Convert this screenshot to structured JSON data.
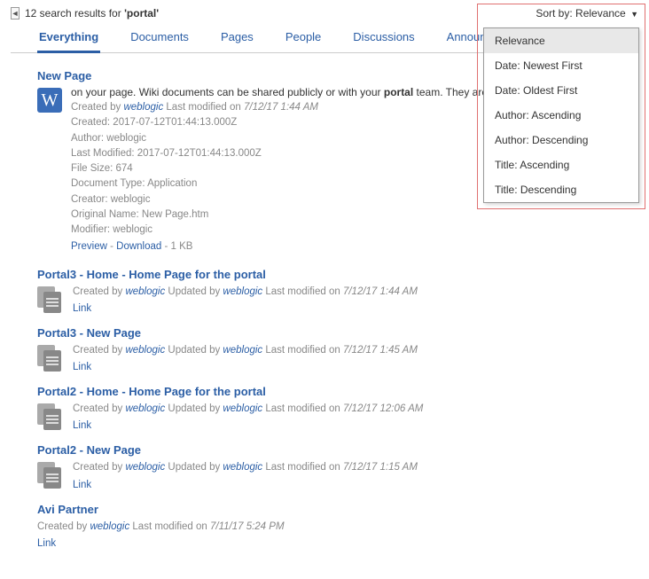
{
  "header": {
    "count_text": "12 search results for ",
    "query": "'portal'",
    "sort_label": "Sort by:",
    "sort_value": "Relevance"
  },
  "tabs": [
    {
      "label": "Everything",
      "active": true
    },
    {
      "label": "Documents",
      "active": false
    },
    {
      "label": "Pages",
      "active": false
    },
    {
      "label": "People",
      "active": false
    },
    {
      "label": "Discussions",
      "active": false
    },
    {
      "label": "Announcements",
      "active": false
    }
  ],
  "sort_options": [
    "Relevance",
    "Date: Newest First",
    "Date: Oldest First",
    "Author: Ascending",
    "Author: Descending",
    "Title: Ascending",
    "Title: Descending"
  ],
  "results": {
    "r0": {
      "title": "New Page",
      "snippet_pre": "on your page. Wiki documents can be shared publicly or with your ",
      "snippet_bold": "portal",
      "snippet_post": " team. They are secured",
      "created_by_label": "Created by ",
      "author": "weblogic",
      "mod_label": " Last modified on ",
      "mod_date": "7/12/17 1:44 AM",
      "details": [
        "Created: 2017-07-12T01:44:13.000Z",
        "Author: weblogic",
        "Last Modified: 2017-07-12T01:44:13.000Z",
        "File Size: 674",
        "Document Type: Application",
        "Creator: weblogic",
        "Original Name: New Page.htm",
        "Modifier: weblogic"
      ],
      "preview": "Preview",
      "download": "Download",
      "size": "1 KB"
    },
    "r1": {
      "title": "Portal3 - Home - Home Page for the portal",
      "created_by_label": "Created by ",
      "author1": "weblogic",
      "updated_label": " Updated by ",
      "author2": "weblogic",
      "mod_label": " Last modified on ",
      "mod_date": "7/12/17 1:44 AM",
      "link": "Link"
    },
    "r2": {
      "title": "Portal3 - New Page",
      "created_by_label": "Created by ",
      "author1": "weblogic",
      "updated_label": " Updated by ",
      "author2": "weblogic",
      "mod_label": " Last modified on ",
      "mod_date": "7/12/17 1:45 AM",
      "link": "Link"
    },
    "r3": {
      "title": "Portal2 - Home - Home Page for the portal",
      "created_by_label": "Created by ",
      "author1": "weblogic",
      "updated_label": " Updated by ",
      "author2": "weblogic",
      "mod_label": " Last modified on ",
      "mod_date": "7/12/17 12:06 AM",
      "link": "Link"
    },
    "r4": {
      "title": "Portal2 - New Page",
      "created_by_label": "Created by ",
      "author1": "weblogic",
      "updated_label": " Updated by ",
      "author2": "weblogic",
      "mod_label": " Last modified on ",
      "mod_date": "7/12/17 1:15 AM",
      "link": "Link"
    },
    "r5": {
      "title": "Avi Partner",
      "created_by_label": "Created by ",
      "author1": "weblogic",
      "mod_label": " Last modified on ",
      "mod_date": "7/11/17 5:24 PM",
      "link": "Link"
    }
  },
  "labels": {
    "sep": " - "
  }
}
